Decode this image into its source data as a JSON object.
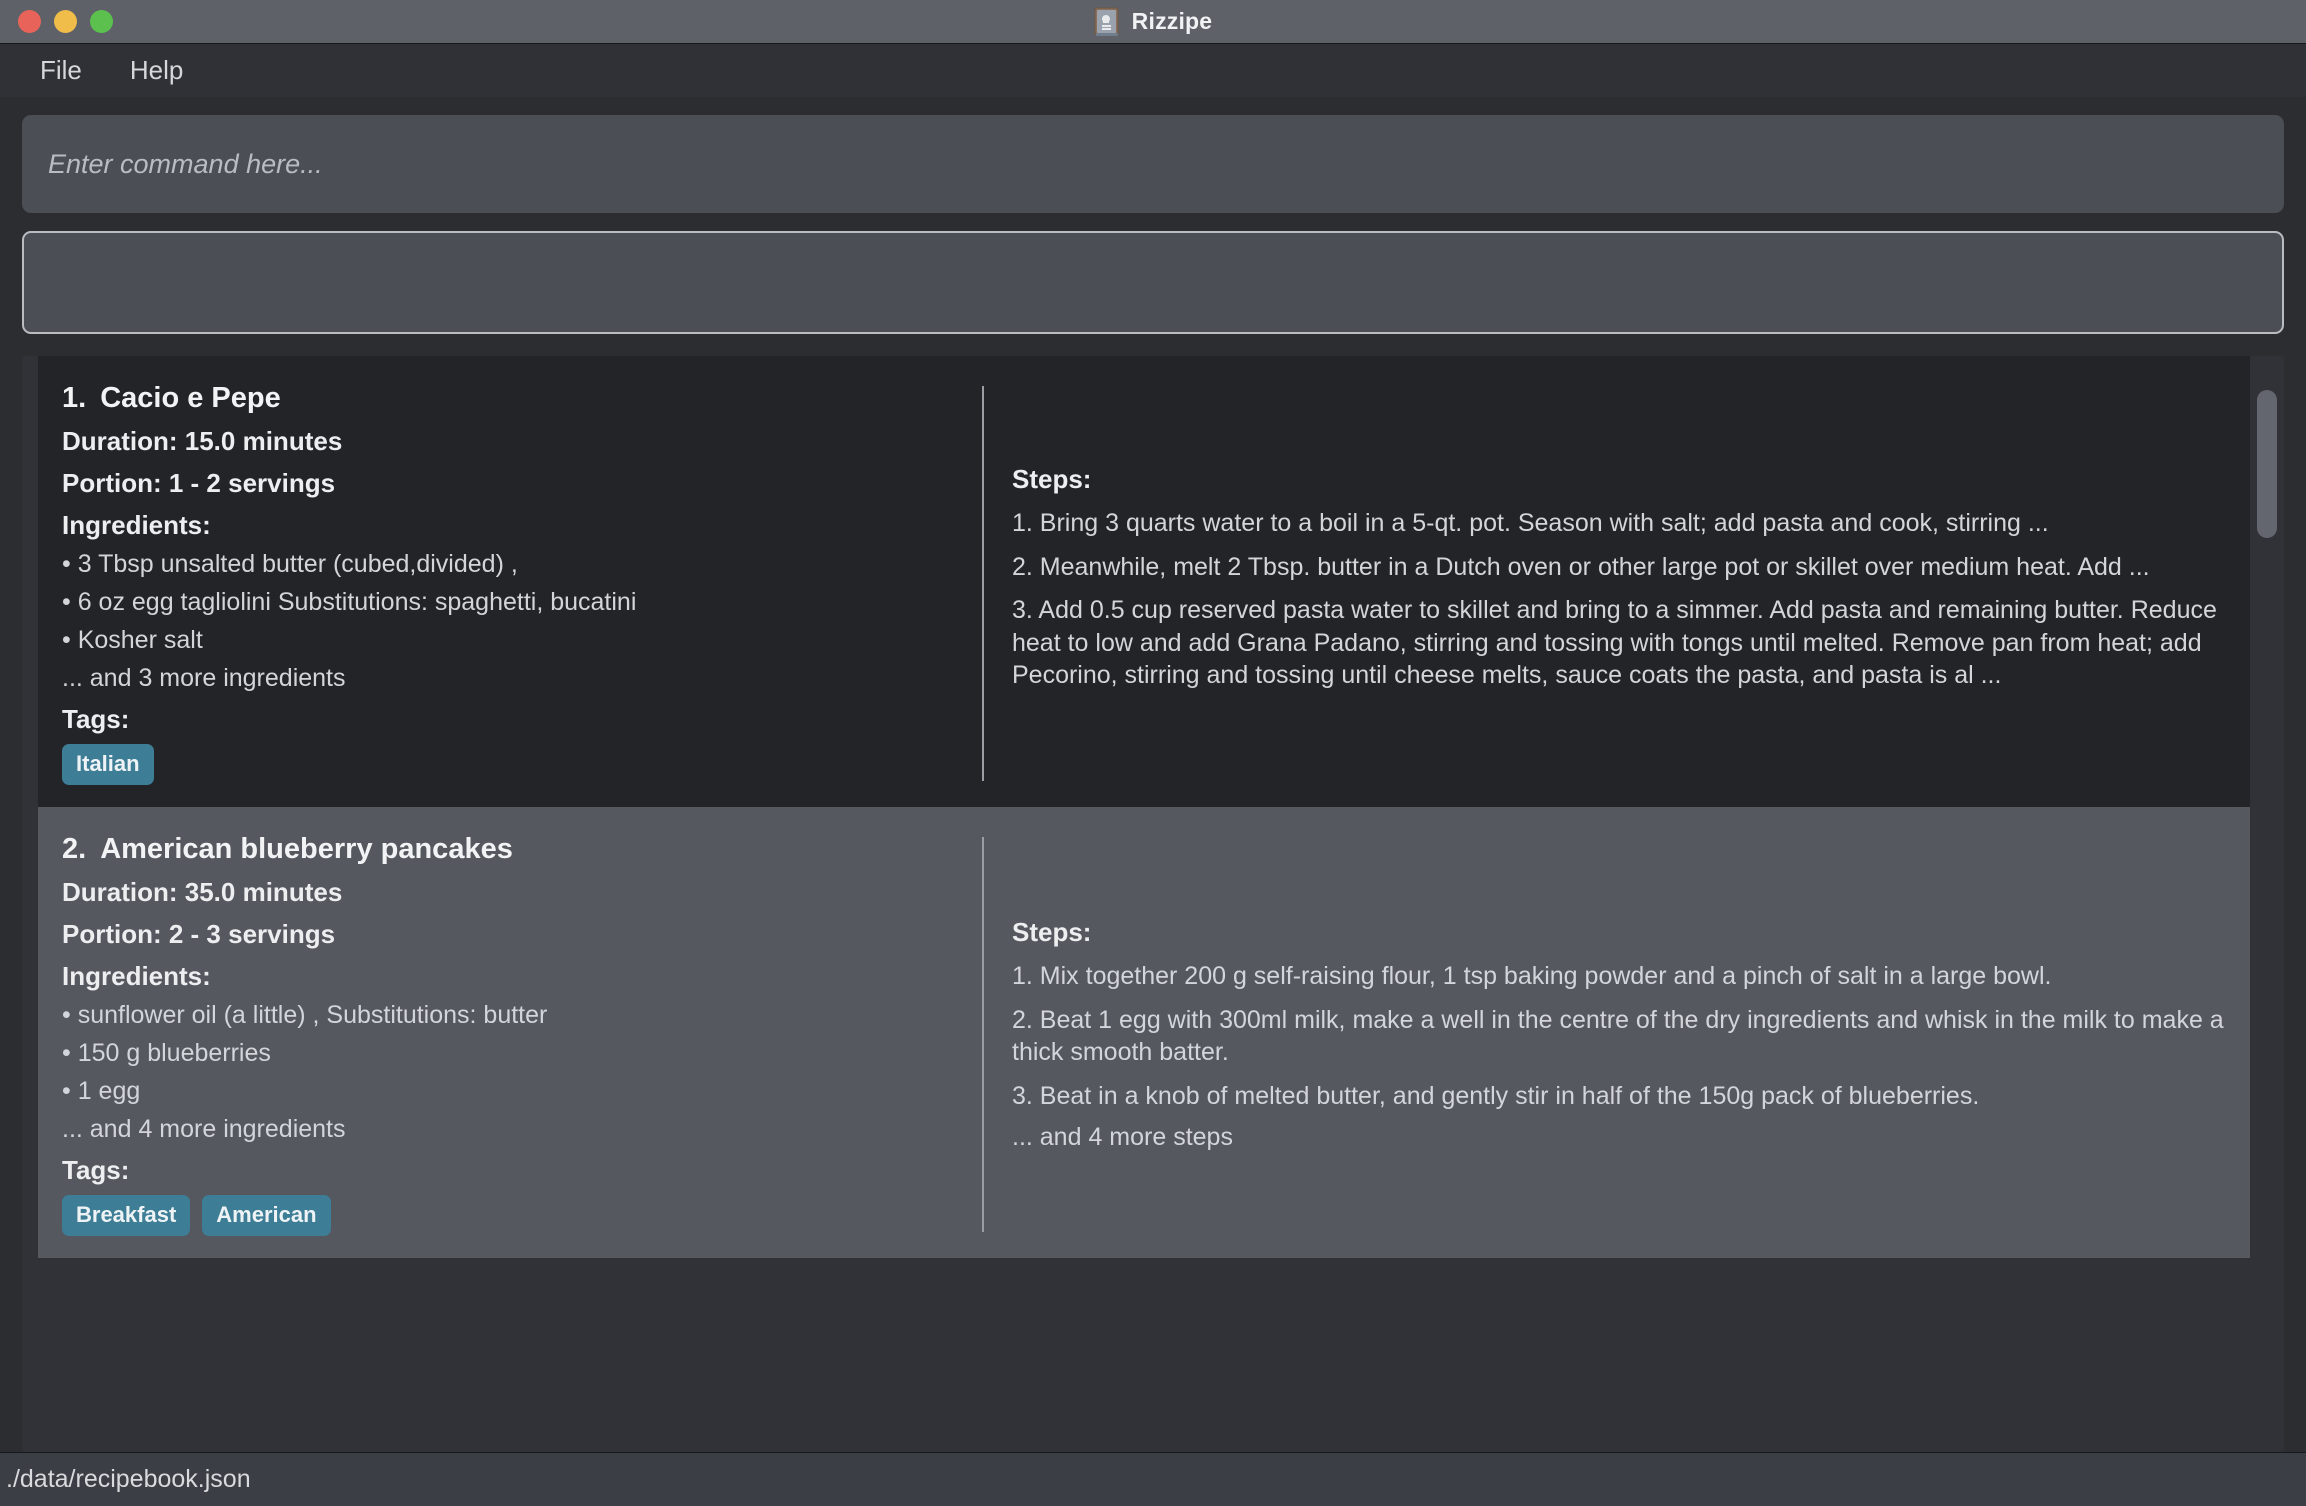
{
  "window": {
    "title": "Rizzipe",
    "icon": "recipe-book-icon",
    "traffic_lights": {
      "close_color": "#e8635a",
      "minimize_color": "#f0bc4a",
      "maximize_color": "#5cc04e"
    }
  },
  "menubar": {
    "items": [
      {
        "label": "File"
      },
      {
        "label": "Help"
      }
    ]
  },
  "command": {
    "value": "",
    "placeholder": "Enter command here..."
  },
  "output": {
    "text": ""
  },
  "theme": {
    "tag_color": "#3d7d96",
    "card_odd_bg": "#232427",
    "card_even_bg": "#55585f",
    "window_bg": "#2b2d31"
  },
  "recipes": [
    {
      "number": "1.",
      "name": "Cacio e Pepe",
      "duration": "Duration: 15.0 minutes",
      "portion": "Portion: 1 - 2 servings",
      "ingredients_label": "Ingredients:",
      "ingredients": [
        "• 3 Tbsp unsalted butter (cubed,divided) ,",
        "• 6 oz egg tagliolini  Substitutions: spaghetti, bucatini",
        "• Kosher salt"
      ],
      "ingredients_more": "... and 3 more ingredients",
      "tags_label": "Tags:",
      "tags": [
        "Italian"
      ],
      "steps_label": "Steps:",
      "steps": [
        "1. Bring 3 quarts water to a boil in a 5-qt. pot. Season with salt; add pasta and cook, stirring ...",
        "2. Meanwhile, melt 2 Tbsp. butter in a Dutch oven or other large pot or skillet over medium heat. Add ...",
        "3. Add 0.5 cup reserved pasta water to skillet and bring to a simmer. Add pasta and remaining butter. Reduce heat to low and add Grana Padano, stirring and tossing with tongs until melted. Remove pan from heat; add Pecorino, stirring and tossing until cheese melts, sauce coats the pasta, and pasta is al ..."
      ],
      "steps_more": ""
    },
    {
      "number": "2.",
      "name": "American blueberry pancakes",
      "duration": "Duration: 35.0 minutes",
      "portion": "Portion: 2 - 3 servings",
      "ingredients_label": "Ingredients:",
      "ingredients": [
        "• sunflower oil (a little) , Substitutions: butter",
        "• 150 g blueberries",
        "• 1 egg"
      ],
      "ingredients_more": "... and 4 more ingredients",
      "tags_label": "Tags:",
      "tags": [
        "Breakfast",
        "American"
      ],
      "steps_label": "Steps:",
      "steps": [
        "1. Mix together 200 g self-raising flour, 1 tsp baking powder and a pinch of salt in a large bowl.",
        "2. Beat 1 egg with 300ml milk, make a well in the centre of the dry ingredients and whisk in the milk to make a thick smooth batter.",
        "3. Beat in a knob of melted butter, and gently stir in half of the 150g pack of blueberries."
      ],
      "steps_more": "... and 4 more steps"
    }
  ],
  "statusbar": {
    "path": "./data/recipebook.json"
  }
}
